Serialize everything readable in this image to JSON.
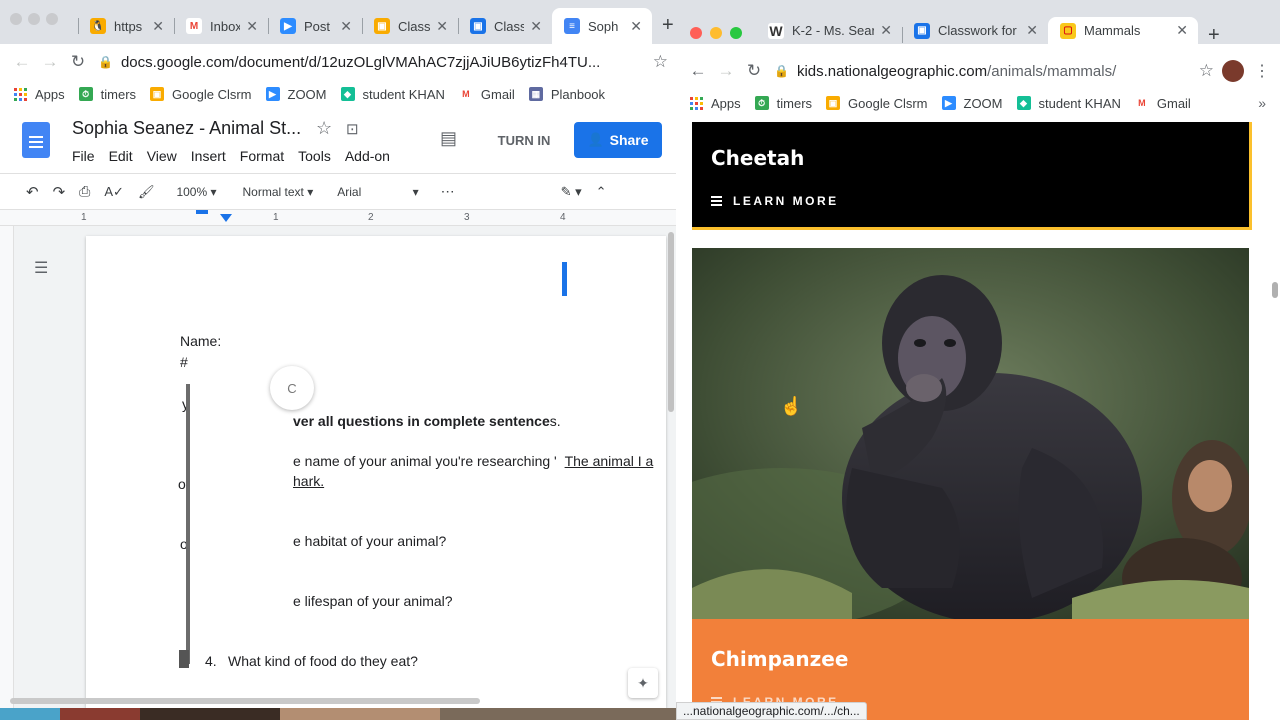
{
  "left_window": {
    "tabs": [
      {
        "title": "https",
        "icon": "penguin-icon",
        "color": "#3c3c3c"
      },
      {
        "title": "Inbox",
        "icon": "gmail-icon",
        "color": "#ea4335"
      },
      {
        "title": "Post",
        "icon": "zoom-icon",
        "color": "#2d8cff"
      },
      {
        "title": "Class",
        "icon": "classroom-icon",
        "color": "#f9ab00"
      },
      {
        "title": "Class",
        "icon": "classroom-icon",
        "color": "#1e8e3e"
      },
      {
        "title": "Soph",
        "icon": "docs-icon",
        "color": "#4285f4"
      }
    ],
    "url": "docs.google.com/document/d/12uzOLglVMAhAC7zjjAJiUB6ytizFh4TU...",
    "bookmarks": [
      "Apps",
      "timers",
      "Google Clsrm",
      "ZOOM",
      "student KHAN",
      "Gmail",
      "Planbook"
    ],
    "docs": {
      "title": "Sophia Seanez - Animal St...",
      "menu": [
        "File",
        "Edit",
        "View",
        "Insert",
        "Format",
        "Tools",
        "Add-on"
      ],
      "turn_in": "TURN IN",
      "share": "Share",
      "zoom": "100%",
      "style": "Normal text",
      "font": "Arial",
      "ruler_ticks": [
        "1",
        "1",
        "2",
        "3",
        "4"
      ],
      "lines": {
        "name": "Name:",
        "hash": "#",
        "y_frag": "y",
        "of_frag": "of",
        "o_frag": "o",
        "spin_letter": "C",
        "instruction": "ver all questions in complete sentence",
        "instruction_tail": "s.",
        "q1": "e name of your animal you're researching '",
        "q1_answer": "The animal I a",
        "q1_answer2": "hark.",
        "q2": "e habitat of your animal?",
        "q3": "e lifespan of your animal?",
        "q4_num": "4.",
        "q4": "What kind of food do they eat?"
      }
    }
  },
  "right_window": {
    "tabs": [
      {
        "title": "K-2 - Ms. Sear",
        "icon": "w-icon",
        "color": "#333333"
      },
      {
        "title": "Classwork for",
        "icon": "classroom-icon",
        "color": "#1e8e3e"
      },
      {
        "title": "Mammals",
        "icon": "natgeo-icon",
        "color": "#f9c81b"
      }
    ],
    "url_domain": "kids.nationalgeographic.com",
    "url_path": "/animals/mammals/",
    "bookmarks": [
      "Apps",
      "timers",
      "Google Clsrm",
      "ZOOM",
      "student KHAN",
      "Gmail"
    ],
    "cards": {
      "cheetah_title": "Cheetah",
      "learn_more": "LEARN MORE",
      "chimp_title": "Chimpanzee",
      "chimp_learn_more": "LEARN MORE"
    },
    "status_url": "...nationalgeographic.com/.../ch..."
  },
  "colors": {
    "docs_blue": "#1a73e8",
    "cheetah_border": "#fbc02d",
    "chimp_orange": "#f2803a"
  }
}
